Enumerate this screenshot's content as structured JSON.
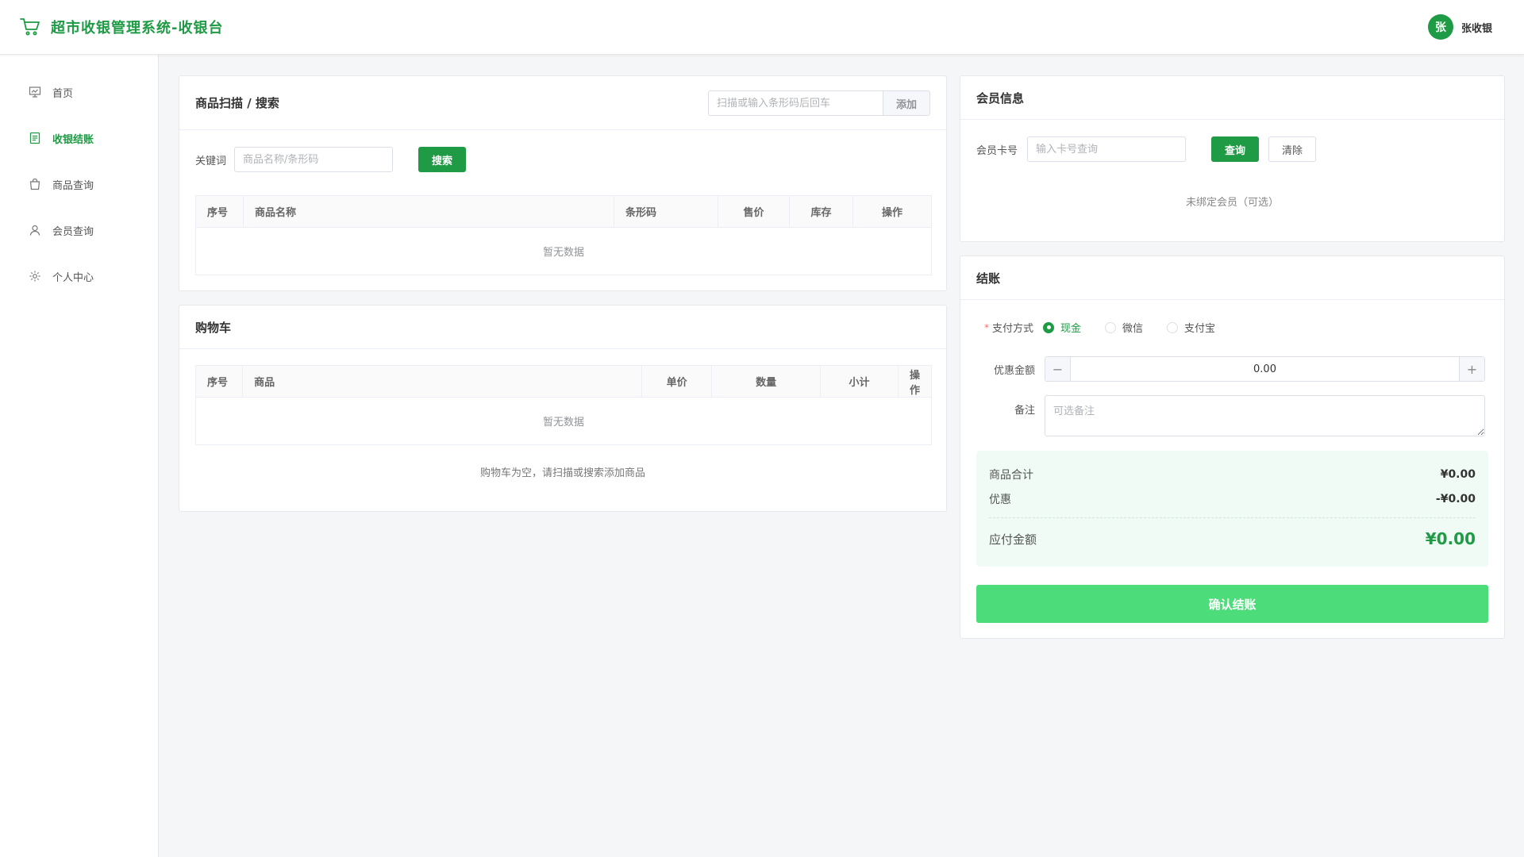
{
  "header": {
    "title": "超市收银管理系统-收银台",
    "avatar_text": "张",
    "username": "张收银"
  },
  "sidebar": {
    "items": [
      {
        "label": "首页",
        "icon": "chart-board-icon",
        "active": false
      },
      {
        "label": "收银结账",
        "icon": "document-icon",
        "active": true
      },
      {
        "label": "商品查询",
        "icon": "shopping-bag-icon",
        "active": false
      },
      {
        "label": "会员查询",
        "icon": "user-icon",
        "active": false
      },
      {
        "label": "个人中心",
        "icon": "gear-icon",
        "active": false
      }
    ]
  },
  "scan": {
    "title": "商品扫描 / 搜索",
    "barcode_placeholder": "扫描或输入条形码后回车",
    "add_label": "添加",
    "keyword_label": "关键词",
    "keyword_placeholder": "商品名称/条形码",
    "search_label": "搜索",
    "columns": [
      "序号",
      "商品名称",
      "条形码",
      "售价",
      "库存",
      "操作"
    ],
    "empty_text": "暂无数据"
  },
  "cart": {
    "title": "购物车",
    "columns": [
      "序号",
      "商品",
      "单价",
      "数量",
      "小计",
      "操作"
    ],
    "empty_text": "暂无数据",
    "empty_message": "购物车为空，请扫描或搜索添加商品"
  },
  "member": {
    "title": "会员信息",
    "card_label": "会员卡号",
    "card_placeholder": "输入卡号查询",
    "query_label": "查询",
    "clear_label": "清除",
    "note": "未绑定会员（可选）"
  },
  "checkout": {
    "title": "结账",
    "pay_label": "支付方式",
    "pay_options": [
      {
        "label": "现金",
        "checked": true
      },
      {
        "label": "微信",
        "checked": false
      },
      {
        "label": "支付宝",
        "checked": false
      }
    ],
    "discount_label": "优惠金额",
    "discount_value": "0.00",
    "minus": "−",
    "plus": "+",
    "remark_label": "备注",
    "remark_placeholder": "可选备注",
    "goods_total_label": "商品合计",
    "goods_total_value": "¥0.00",
    "discount_summary_label": "优惠",
    "discount_summary_value": "-¥0.00",
    "payable_label": "应付金额",
    "payable_value": "¥0.00",
    "confirm_label": "确认结账"
  },
  "colors": {
    "accent": "#1f9a45",
    "confirm_button": "#4cdc7a",
    "summary_bg": "#effbf4"
  }
}
